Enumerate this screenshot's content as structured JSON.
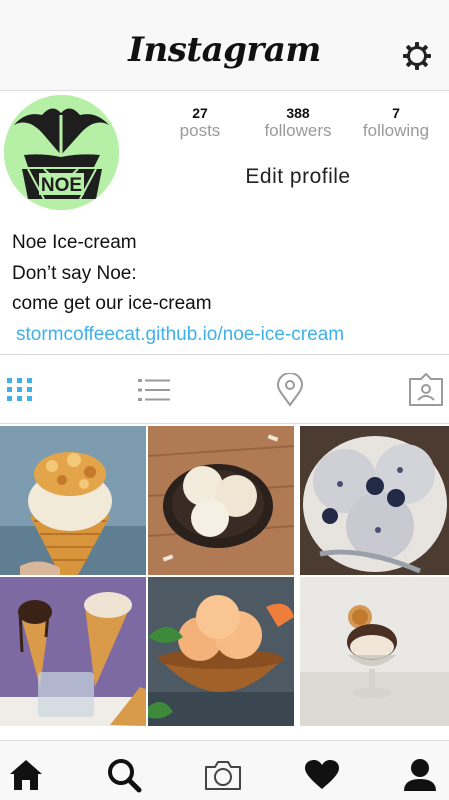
{
  "header": {
    "logo": "Instagram"
  },
  "profile": {
    "avatar_text": "NOE",
    "stats": [
      {
        "count": "27",
        "label": "posts"
      },
      {
        "count": "388",
        "label": "followers"
      },
      {
        "count": "7",
        "label": "following"
      }
    ],
    "edit_label": "Edit profile",
    "bio": {
      "name": "Noe Ice-cream",
      "line1": "Don’t say Noe:",
      "line2": "come get our ice-cream",
      "link": "stormcoffeecat.github.io/noe-ice-cream"
    }
  },
  "colors": {
    "accent": "#3fb1e8",
    "avatar_bg": "#b6f0a6"
  }
}
